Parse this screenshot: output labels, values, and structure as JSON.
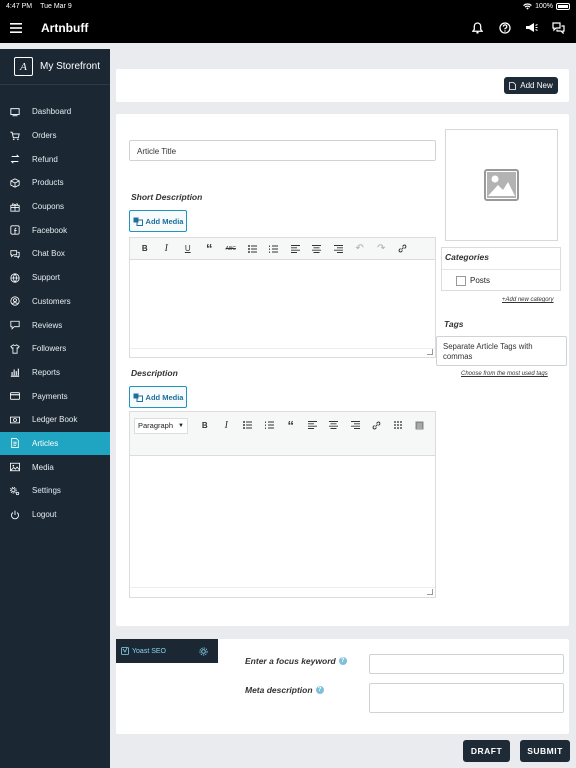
{
  "status": {
    "time": "4:47 PM",
    "date": "Tue Mar 9",
    "battery": "100%"
  },
  "appbar": {
    "title": "Artnbuff"
  },
  "sidebar": {
    "store": "My Storefront",
    "items": [
      {
        "label": "Dashboard",
        "icon": "dashboard-icon"
      },
      {
        "label": "Orders",
        "icon": "cart-icon"
      },
      {
        "label": "Refund",
        "icon": "refund-icon"
      },
      {
        "label": "Products",
        "icon": "cube-icon"
      },
      {
        "label": "Coupons",
        "icon": "gift-icon"
      },
      {
        "label": "Facebook",
        "icon": "facebook-icon"
      },
      {
        "label": "Chat Box",
        "icon": "chat-icon"
      },
      {
        "label": "Support",
        "icon": "globe-icon"
      },
      {
        "label": "Customers",
        "icon": "user-circle-icon"
      },
      {
        "label": "Reviews",
        "icon": "comment-icon"
      },
      {
        "label": "Followers",
        "icon": "shirt-icon"
      },
      {
        "label": "Reports",
        "icon": "chart-icon"
      },
      {
        "label": "Payments",
        "icon": "card-icon"
      },
      {
        "label": "Ledger Book",
        "icon": "money-icon"
      },
      {
        "label": "Articles",
        "icon": "document-icon",
        "active": true
      },
      {
        "label": "Media",
        "icon": "image-icon"
      },
      {
        "label": "Settings",
        "icon": "gears-icon"
      },
      {
        "label": "Logout",
        "icon": "power-icon"
      }
    ]
  },
  "header": {
    "add_new": "Add New"
  },
  "form": {
    "title_value": "Article Title",
    "short_description_label": "Short Description",
    "description_label": "Description",
    "add_media": "Add Media",
    "paragraph": "Paragraph",
    "categories_label": "Categories",
    "category_option": "Posts",
    "add_category": "+Add new category",
    "tags_label": "Tags",
    "tags_placeholder": "Separate Article Tags with commas",
    "tags_hint": "Choose from the most used tags"
  },
  "seo": {
    "tab": "Yoast SEO",
    "focus_label": "Enter a focus keyword",
    "meta_label": "Meta description"
  },
  "footer": {
    "draft": "DRAFT",
    "submit": "SUBMIT"
  },
  "colors": {
    "accent": "#1fa5c2",
    "sidebar": "#1b2834",
    "dark_button": "#1e2b37"
  }
}
